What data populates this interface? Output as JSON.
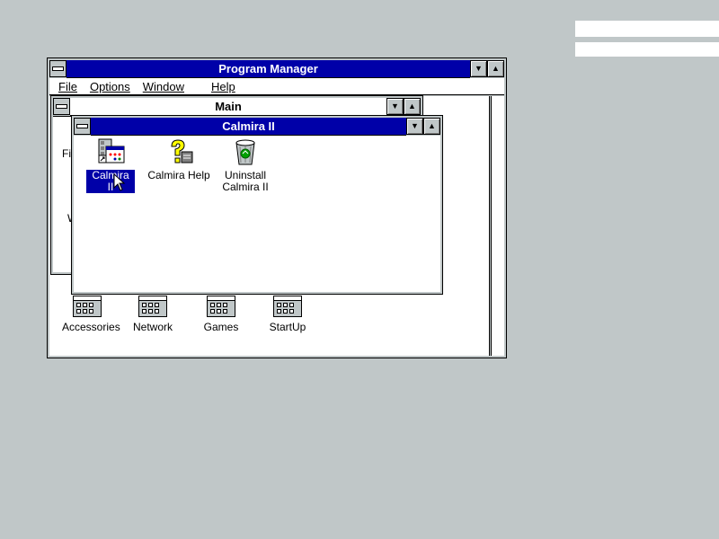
{
  "desktop": {
    "background": "#c0c7c8"
  },
  "program_manager": {
    "title": "Program Manager",
    "menu": [
      {
        "label": "File",
        "accel": "F"
      },
      {
        "label": "Options",
        "accel": "O"
      },
      {
        "label": "Window",
        "accel": "W"
      },
      {
        "label": "Help",
        "accel": "H"
      }
    ],
    "groups": [
      {
        "label": "Accessories"
      },
      {
        "label": "Network"
      },
      {
        "label": "Games"
      },
      {
        "label": "StartUp"
      }
    ]
  },
  "main_window": {
    "title": "Main",
    "partial_labels": [
      "Fi",
      "W"
    ]
  },
  "calmira_window": {
    "title": "Calmira II",
    "icons": [
      {
        "label": "Calmira II",
        "icon": "calmira-app-icon",
        "selected": true
      },
      {
        "label": "Calmira Help",
        "icon": "help-question-icon",
        "selected": false
      },
      {
        "label": "Uninstall\nCalmira II",
        "icon": "recycle-bin-icon",
        "selected": false
      }
    ]
  },
  "colors": {
    "active_title": "#0000a8",
    "window_bg": "#ffffff",
    "button_face": "#c0c7c8"
  }
}
